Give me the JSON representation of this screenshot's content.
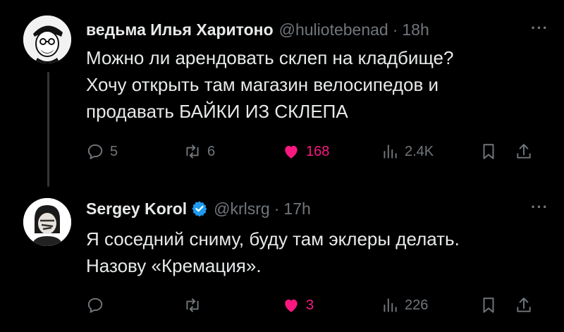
{
  "tweet1": {
    "name": "ведьма Илья Харитоно",
    "handle": "@huliotebenad",
    "dot": "·",
    "time": "18h",
    "more": "···",
    "lines": [
      "Можно ли арендовать склеп на кладбище?",
      "Хочу открыть там магазин велосипедов и",
      "продавать БАЙКИ ИЗ СКЛЕПА"
    ],
    "replies": "5",
    "retweets": "6",
    "likes": "168",
    "views": "2.4K",
    "liked": true
  },
  "tweet2": {
    "name": "Sergey Korol",
    "handle": "@krlsrg",
    "dot": "·",
    "time": "17h",
    "more": "···",
    "verified": true,
    "lines": [
      "Я соседний сниму, буду там эклеры делать.",
      "Назову «Кремация»."
    ],
    "replies": "",
    "retweets": "",
    "likes": "3",
    "views": "226",
    "liked": true
  },
  "colors": {
    "background": "#000000",
    "text": "#e7e9ea",
    "muted": "#71767b",
    "like": "#f91880",
    "verified": "#1d9bf0"
  }
}
